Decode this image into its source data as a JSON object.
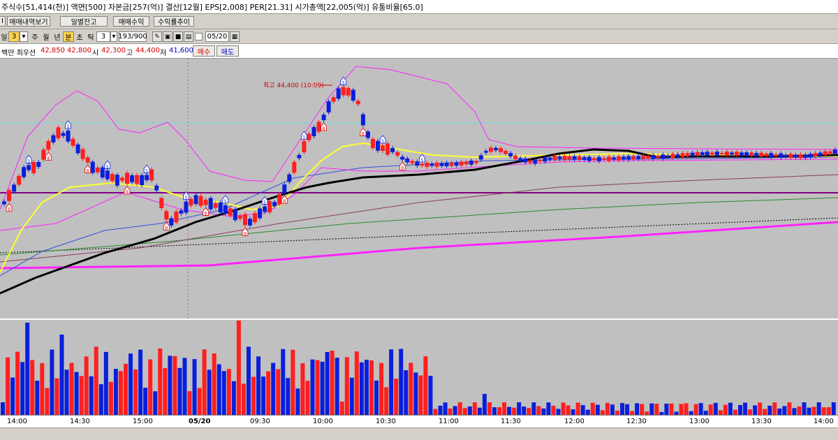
{
  "info_bar": {
    "text": "주식수[51,414(천)] 액면[500] 자본금[257(억)] 결산[12월] EPS[2,008] PER[21.31] 시가총액[22,005(억)] 유통비율[65.0]"
  },
  "toolbar": {
    "tabs": [
      "매매내역보기",
      "일별잔고",
      "매매수익",
      "수익률추이"
    ]
  },
  "period_bar": {
    "period_selected": "3",
    "periods": [
      "주",
      "월",
      "년",
      "분",
      "초",
      "틱"
    ],
    "tick_value": "3",
    "count_value": "193/900",
    "date_value": "05/20",
    "partial_label_left": "일"
  },
  "quote": {
    "partial_name": "백만 최우선",
    "best_ask": "42,850",
    "best_bid": "42,800",
    "open_label": "시",
    "open": "42,300",
    "high_label": "고",
    "high": "44,400",
    "low_label": "저",
    "low": "41,600",
    "buy_button": "매수",
    "sell_button": "매도"
  },
  "chart": {
    "annotation_high": "최고 44,400 (10:09)",
    "colors": {
      "up": "#ff1f1f",
      "down": "#0a1fdc",
      "bg": "#c0c0c0",
      "ma_black": "#000000",
      "ma_yellow": "#ffff33",
      "band": "#ff22ff",
      "hline": "#800080"
    }
  },
  "time_axis": {
    "labels": [
      "14:00",
      "14:30",
      "15:00",
      "05/20",
      "09:30",
      "10:00",
      "10:30",
      "11:00",
      "11:30",
      "12:00",
      "12:30",
      "13:00",
      "13:30",
      "14:00"
    ]
  }
}
